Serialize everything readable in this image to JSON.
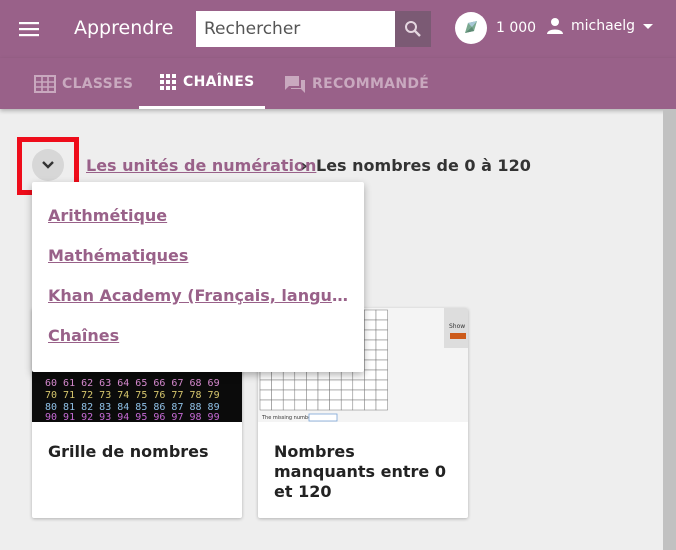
{
  "header": {
    "app_title": "Apprendre",
    "search": {
      "placeholder": "Rechercher",
      "value": ""
    },
    "points": "1 000",
    "username": "michaelg",
    "icons": {
      "menu": "hamburger-menu-icon",
      "search": "search-icon",
      "points": "points-star-icon",
      "user": "person-icon",
      "dropdown": "arrow-drop-down-icon"
    }
  },
  "tabs": [
    {
      "label": "CLASSES",
      "icon": "classroom-grid-icon",
      "active": false
    },
    {
      "label": "CHAÎNES",
      "icon": "apps-grid-icon",
      "active": true
    },
    {
      "label": "RECOMMANDÉ",
      "icon": "forum-icon",
      "active": false
    }
  ],
  "breadcrumbs": {
    "toggle_icon": "chevron-down-icon",
    "parent": "Les unités de numération",
    "separator": "›",
    "current": "Les nombres de 0 à 120"
  },
  "dropdown": {
    "items": [
      "Arithmétique",
      "Mathématiques",
      "Khan Academy (Français, langue fr…",
      "Chaînes"
    ]
  },
  "cards": [
    {
      "title": "Grille de nombres",
      "thumb_rows": [
        "60 61 62 63 64 65 66 67 68 69",
        "70 71 72 73 74 75 76 77 78 79",
        "80 81 82 83 84 85 86 87 88 89",
        "90 91 92 93 94 95 96 97 98 99"
      ]
    },
    {
      "title": "Nombres manquants entre 0 et 120",
      "thumb_caption": "The missing number is",
      "thumb_button": "Show"
    }
  ],
  "colors": {
    "primary": "#996189",
    "highlight": "#ee0c1a",
    "search_button": "#7b5a74"
  }
}
